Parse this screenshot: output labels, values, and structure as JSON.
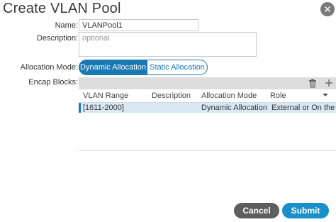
{
  "dialog": {
    "title": "Create VLAN Pool",
    "close_glyph": "✕"
  },
  "form": {
    "name_label": "Name:",
    "name_value": "VLANPool1",
    "description_label": "Description:",
    "description_placeholder": "optional",
    "allocation_label": "Allocation Mode:",
    "allocation_options": [
      "Dynamic Allocation",
      "Static Allocation"
    ],
    "allocation_selected": "Dynamic Allocation",
    "encap_label": "Encap Blocks:"
  },
  "toolbar": {
    "delete_icon": "trash-icon",
    "add_icon": "plus-icon"
  },
  "table": {
    "columns": [
      "VLAN Range",
      "Description",
      "Allocation Mode",
      "Role"
    ],
    "rows": [
      {
        "range": "[1611-2000]",
        "description": "",
        "allocation": "Dynamic Allocation",
        "role": "External or On the wi..."
      }
    ]
  },
  "footer": {
    "cancel_label": "Cancel",
    "submit_label": "Submit"
  },
  "colors": {
    "accent": "#1a78b4",
    "submit": "#1a8fc9",
    "cancel": "#5e5e5e",
    "selected_row": "#d9e8f4"
  }
}
